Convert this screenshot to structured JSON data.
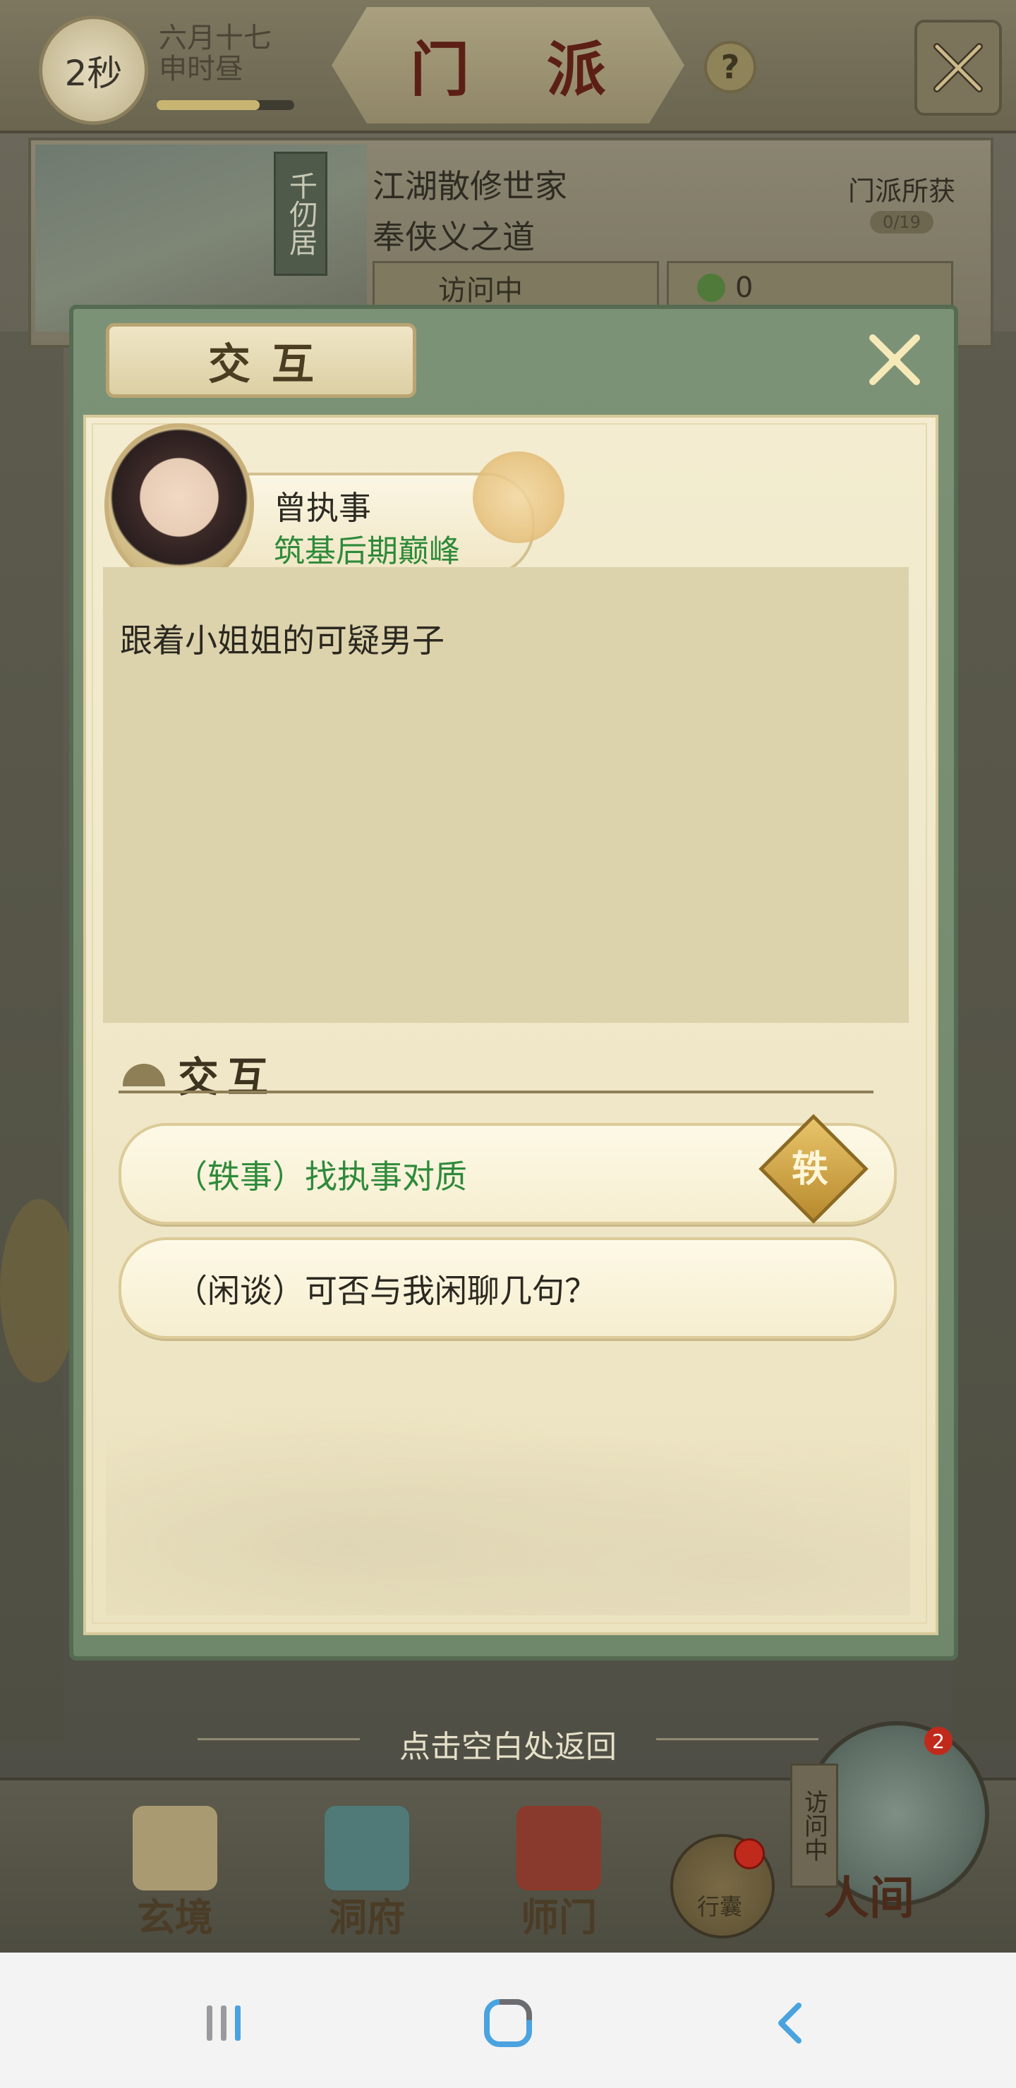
{
  "top_bar": {
    "timer": "2秒",
    "lunar_date_line1": "六月十七",
    "lunar_date_line2": "申时昼",
    "time_progress": 0.75,
    "title": "门 派",
    "help_symbol": "?"
  },
  "sect": {
    "name": "千仞居",
    "desc_line1": "江湖散修世家",
    "desc_line2": "奉侠义之道",
    "gain_label": "门派所获",
    "gain_count": "0/19",
    "status_label": "访问中",
    "coin_value": "0"
  },
  "modal": {
    "title": "交互",
    "npc": {
      "name": "曾执事",
      "realm": "筑基后期巅峰"
    },
    "description": "跟着小姐姐的可疑男子",
    "section_title": "交互",
    "options": [
      {
        "text": "（轶事）找执事对质",
        "color": "#2e8a3a",
        "badge": "轶"
      },
      {
        "text": "（闲谈）可否与我闲聊几句？",
        "color": "#2b2820",
        "badge": ""
      }
    ]
  },
  "return_hint": "点击空白处返回",
  "bottom_nav": {
    "items": [
      {
        "label": "玄境",
        "icon": "scroll-icon"
      },
      {
        "label": "洞府",
        "icon": "pavilion-icon"
      },
      {
        "label": "师门",
        "icon": "banner-icon"
      }
    ],
    "bag_label": "行囊",
    "world_tag": "访问中",
    "world_label": "人间",
    "world_badge": "2"
  },
  "colors": {
    "accent_green": "#2e8a3a",
    "title_red": "#5c1f16",
    "modal_green": "#6f886b"
  }
}
